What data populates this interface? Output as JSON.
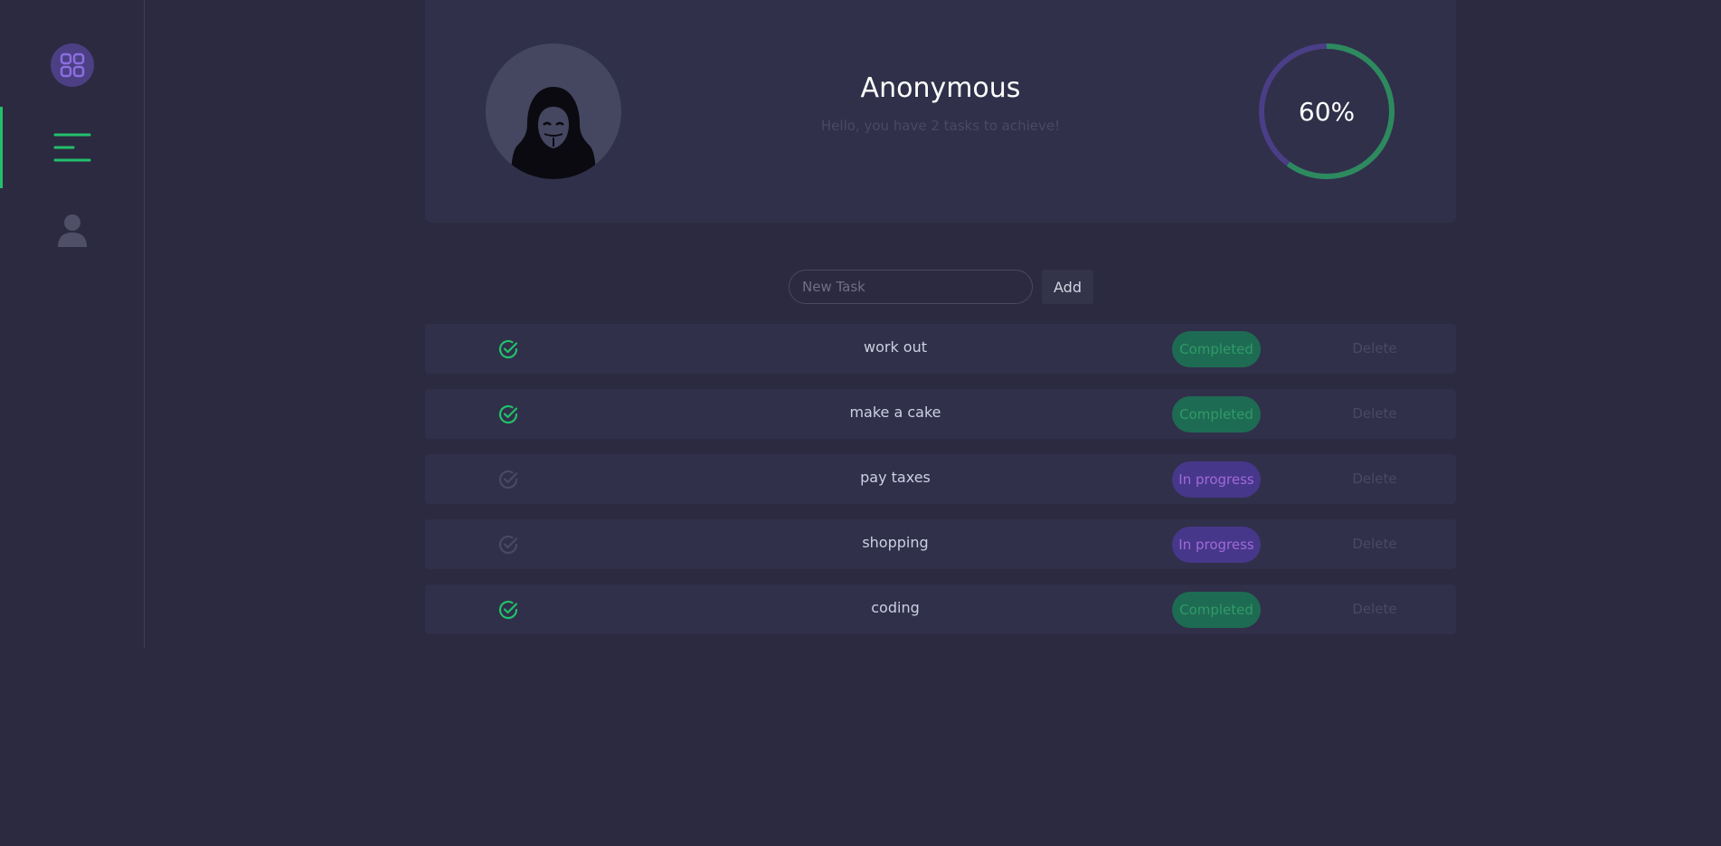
{
  "sidebar": {
    "items": [
      {
        "icon": "apps-icon",
        "active": false
      },
      {
        "icon": "menu-icon",
        "active": true
      },
      {
        "icon": "user-icon",
        "active": false
      }
    ],
    "active_color": "#22c06b"
  },
  "profile": {
    "username": "Anonymous",
    "greeting": "Hello, you have 2 tasks to achieve!",
    "avatar_icon": "anonymous-hacker-icon",
    "progress_percent": 60,
    "progress_label": "60%",
    "progress_color": "#2d8a5e",
    "progress_track_color": "#4a3e87"
  },
  "new_task": {
    "placeholder": "New Task",
    "value": "",
    "add_label": "Add"
  },
  "tasks": [
    {
      "name": "work out",
      "status": "Completed",
      "done": true,
      "delete_label": "Delete"
    },
    {
      "name": "make a cake",
      "status": "Completed",
      "done": true,
      "delete_label": "Delete"
    },
    {
      "name": "pay taxes",
      "status": "In progress",
      "done": false,
      "delete_label": "Delete"
    },
    {
      "name": "shopping",
      "status": "In progress",
      "done": false,
      "delete_label": "Delete"
    },
    {
      "name": "coding",
      "status": "Completed",
      "done": true,
      "delete_label": "Delete"
    }
  ],
  "colors": {
    "background": "#2c2a41",
    "card": "#30304a",
    "completed_badge": "#1e6b53",
    "progress_badge": "#47378a",
    "check_done": "#22c06b",
    "check_pending": "#4a4963"
  }
}
